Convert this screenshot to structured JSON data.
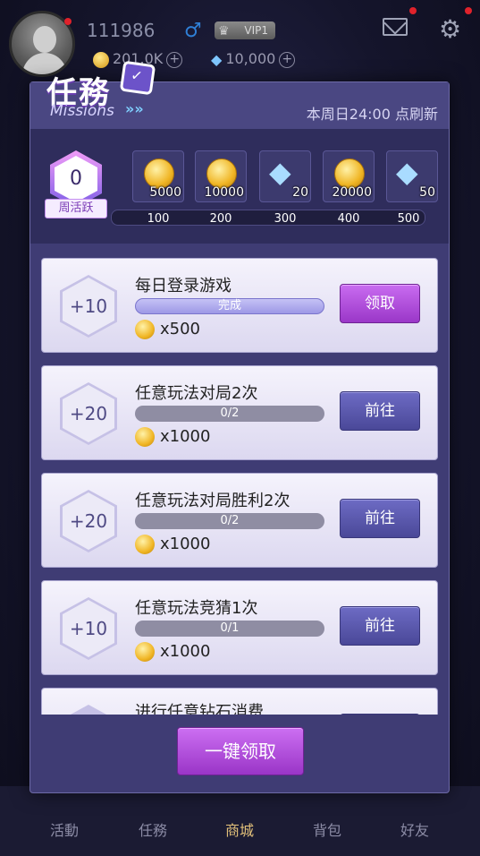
{
  "user": {
    "id": "111986",
    "gender_symbol": "♂",
    "vip": "VIP1",
    "gold": "201.0K",
    "diamonds": "10,000"
  },
  "bottom_nav": [
    {
      "label": "活動"
    },
    {
      "label": "任務"
    },
    {
      "label": "商城"
    },
    {
      "label": "背包"
    },
    {
      "label": "好友"
    }
  ],
  "missions_panel": {
    "title_cn": "任務",
    "title_en": "Missions",
    "refresh_text": "本周日24:00 点刷新",
    "weekly_activity": {
      "value": "0",
      "label": "周活跃",
      "rewards": [
        {
          "type": "coin",
          "amount": "5000",
          "milestone": "100"
        },
        {
          "type": "coin",
          "amount": "10000",
          "milestone": "200"
        },
        {
          "type": "diamond",
          "amount": "20",
          "milestone": "300"
        },
        {
          "type": "coin",
          "amount": "20000",
          "milestone": "400"
        },
        {
          "type": "diamond",
          "amount": "50",
          "milestone": "500"
        }
      ]
    },
    "missions": [
      {
        "points": "+10",
        "title": "每日登录游戏",
        "progress": "完成",
        "done": true,
        "reward": "x500",
        "button": "领取"
      },
      {
        "points": "+20",
        "title": "任意玩法对局2次",
        "progress": "0/2",
        "done": false,
        "reward": "x1000",
        "button": "前往"
      },
      {
        "points": "+20",
        "title": "任意玩法对局胜利2次",
        "progress": "0/2",
        "done": false,
        "reward": "x1000",
        "button": "前往"
      },
      {
        "points": "+10",
        "title": "任意玩法竞猜1次",
        "progress": "0/1",
        "done": false,
        "reward": "x1000",
        "button": "前往"
      },
      {
        "points": "",
        "title": "进行任意钻石消费",
        "progress": "",
        "done": false,
        "reward": "",
        "button": ""
      }
    ],
    "claim_all_label": "一键领取"
  }
}
